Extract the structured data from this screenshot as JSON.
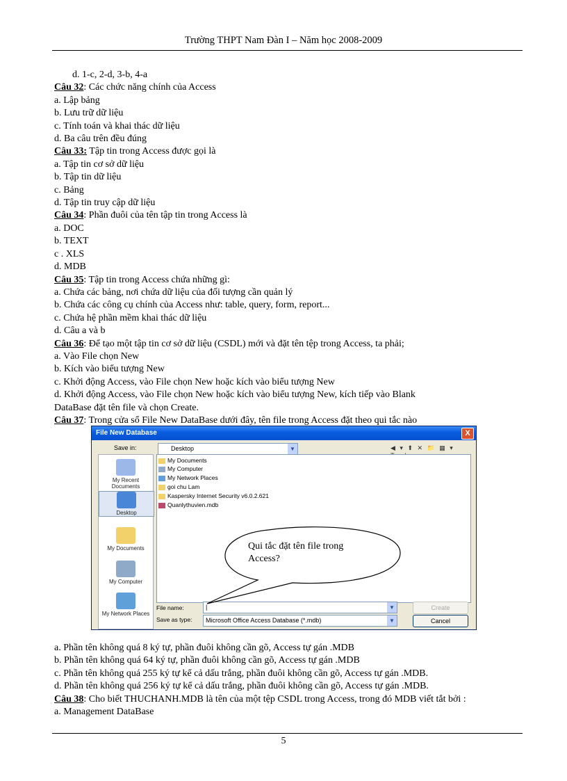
{
  "header": "Trường THPT Nam Đàn I – Năm học 2008-2009",
  "page_number": "5",
  "lines": [
    {
      "type": "indent",
      "text": "d.   1-c, 2-d, 3-b, 4-a"
    },
    {
      "type": "q",
      "label": "Câu 32",
      "text": ": Các chức năng chính  của Access"
    },
    {
      "type": "t",
      "text": "a. Lập bảng"
    },
    {
      "type": "t",
      "text": "b. Lưu trữ dữ liệu"
    },
    {
      "type": "t",
      "text": "c. Tính  toán và khai thác dữ liệu"
    },
    {
      "type": "t",
      "text": "d. Ba câu trên đều đúng"
    },
    {
      "type": "q",
      "label": "Câu 33:",
      "text": " Tập tin trong  Access được gọi là"
    },
    {
      "type": "t",
      "text": "a. Tập tin cơ sở dữ liệu"
    },
    {
      "type": "t",
      "text": "b. Tập tin  dữ liệu"
    },
    {
      "type": "t",
      "text": "c. Bảng"
    },
    {
      "type": "t",
      "text": "d. Tập tin truy  cập dữ liệu"
    },
    {
      "type": "q",
      "label": "Câu 34",
      "text": ": Phần đuôi của tên tập tin trong Access là"
    },
    {
      "type": "t",
      "text": "a. DOC"
    },
    {
      "type": "t",
      "text": "b. TEXT"
    },
    {
      "type": "t",
      "text": "c . XLS"
    },
    {
      "type": "t",
      "text": "d. MDB"
    },
    {
      "type": "q",
      "label": "Câu 35",
      "text": ": Tập tin trong  Access chứa những  gì:"
    },
    {
      "type": "t",
      "text": "a. Chứa các bảng, nơi chứa dữ liệu  của đối tượng cần quản lý"
    },
    {
      "type": "t",
      "text": "b. Chứa các công cụ chính  của Access như: table, query, form,  report..."
    },
    {
      "type": "t",
      "text": "c. Chứa hệ phần mềm  khai thác dữ liệu"
    },
    {
      "type": "t",
      "text": "d. Câu a và b"
    },
    {
      "type": "q",
      "label": "Câu 36",
      "text": ": Để tạo một tập tin  cơ sở dữ liệu  (CSDL)  mới  và đặt tên tệp trong Access, ta phải;"
    },
    {
      "type": "t",
      "text": "a. Vào File  chọn New"
    },
    {
      "type": "t",
      "text": "b. Kích vào biểu  tượng  New"
    },
    {
      "type": "t",
      "text": "c. Khởi động Access, vào File chọn  New hoặc kích vào biểu tượng New"
    },
    {
      "type": "t",
      "text": "d. Khởi động Access, vào File  chọn New hoặc kích vào biểu tượng New, kích tiếp vào Blank"
    },
    {
      "type": "t",
      "text": "DataBase đặt tên file  và chọn  Create."
    },
    {
      "type": "q",
      "label": "Câu 37",
      "text": ": Trong  cửa sổ File  New DataBase dưới đây, tên file  trong Access  đặt theo qui tắc nào"
    }
  ],
  "lines_after": [
    {
      "type": "t",
      "text": "a. Phần tên không  quá 8 ký tự, phần  đuôi không  cần gõ, Access tự gán .MDB"
    },
    {
      "type": "t",
      "text": "b. Phần tên không  quá 64 ký tự, phần đuôi không  cần gõ, Access tự gán .MDB"
    },
    {
      "type": "t",
      "text": "c. Phần tên không  quá 255 ký tự kể cả dấu trắng, phần đuôi không  cần gõ, Access tự gán .MDB."
    },
    {
      "type": "t",
      "text": "d. Phần tên không  quá 256 ký tự kể cả dấu trắng, phần đuôi không  cần gõ, Access tự gán .MDB."
    },
    {
      "type": "q",
      "label": "Câu 38",
      "text": ": Cho biết   THUCHANH.MDB  là tên của một tệp CSDL trong Access, trong đó MDB viết tắt bởi :"
    },
    {
      "type": "t",
      "text": "a. Management  DataBase"
    }
  ],
  "dialog": {
    "title": "File New Database",
    "close": "X",
    "save_in_label": "Save in:",
    "save_in_value": "Desktop",
    "tools": "◀ ▾ ⬆ ✕ 📁 ▦ ▾ Tools ▾",
    "places": [
      "My Recent Documents",
      "Desktop",
      "My Documents",
      "My Computer",
      "My Network Places"
    ],
    "files": [
      "My Documents",
      "My Computer",
      "My Network Places",
      "goi chu Lam",
      "Kaspersky Internet Security v6.0.2.621",
      "Quanlythuvien.mdb"
    ],
    "file_name_label": "File name:",
    "file_name_value": "|",
    "save_type_label": "Save as type:",
    "save_type_value": "Microsoft Office Access Database (*.mdb)",
    "create": "Create",
    "cancel": "Cancel"
  },
  "callout": "Qui tắc đặt tên file  trong Access?"
}
